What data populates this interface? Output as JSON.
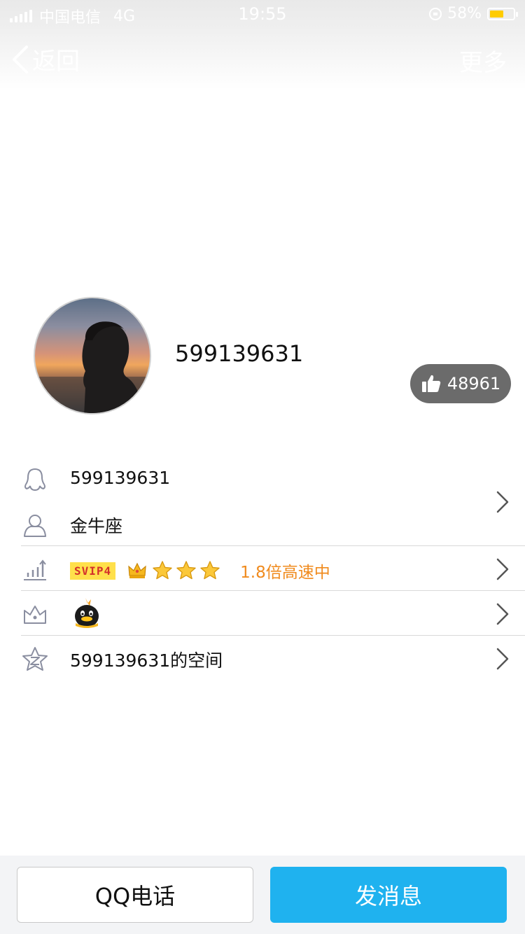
{
  "status_bar": {
    "carrier": "中国电信",
    "network": "4G",
    "time": "19:55",
    "battery_percent": "58%",
    "battery_level": 0.58
  },
  "nav": {
    "back_label": "返回",
    "more_label": "更多"
  },
  "profile": {
    "nickname": "599139631",
    "likes": "48961"
  },
  "info": {
    "qq_number": "599139631",
    "zodiac": "金牛座",
    "vip_badge": "SVIP4",
    "vip_stars": 3,
    "vip_speed": "1.8倍高速中",
    "qzone_label": "599139631的空间"
  },
  "actions": {
    "call_label": "QQ电话",
    "message_label": "发消息"
  },
  "colors": {
    "accent": "#1fb2ef",
    "vip_speed": "#f08b1e",
    "like_pill": "#6b6b6b"
  },
  "icons": [
    "qq-penguin-icon",
    "person-icon",
    "level-up-icon",
    "crown-icon",
    "qzone-icon",
    "chevron-right-icon",
    "thumb-up-icon",
    "back-arrow-icon"
  ]
}
